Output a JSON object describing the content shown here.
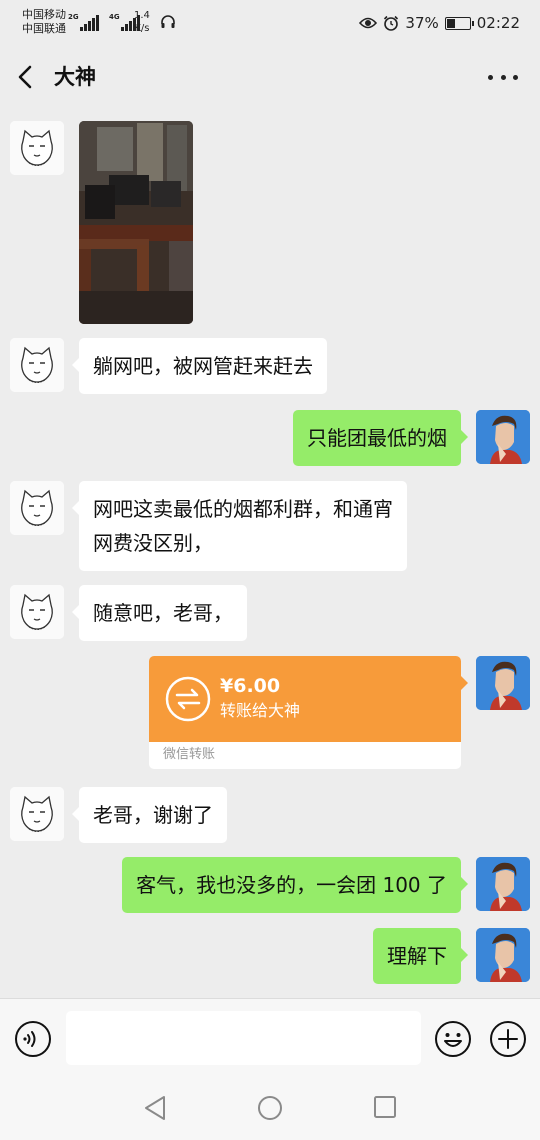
{
  "status_bar": {
    "carrier_1": "中国移动",
    "carrier_2": "中国联通",
    "net_1": "2G",
    "net_2": "4G",
    "speed_value": "1.4",
    "speed_unit": "K/s",
    "battery": "37%",
    "time": "02:22",
    "icons": [
      "signal-icon",
      "headset-icon",
      "eye-icon",
      "alarm-icon",
      "battery-icon"
    ]
  },
  "header": {
    "title": "大神",
    "back_icon": "chevron-left-icon",
    "more_icon": "more-icon"
  },
  "messages": [
    {
      "side": "left",
      "type": "image"
    },
    {
      "side": "left",
      "type": "text",
      "text": "躺网吧，被网管赶来赶去"
    },
    {
      "side": "right",
      "type": "text",
      "text": "只能团最低的烟"
    },
    {
      "side": "left",
      "type": "text",
      "lines": [
        "网吧这卖最低的烟都利群，和通宵",
        "网费没区别，"
      ]
    },
    {
      "side": "left",
      "type": "text",
      "text": "随意吧，老哥，"
    },
    {
      "side": "right",
      "type": "transfer",
      "amount": "¥6.00",
      "desc": "转账给大神",
      "footer": "微信转账"
    },
    {
      "side": "left",
      "type": "text",
      "text": "老哥，谢谢了"
    },
    {
      "side": "right",
      "type": "text",
      "text": "客气，我也没多的，一会团 100 了"
    },
    {
      "side": "right",
      "type": "text",
      "text": "理解下"
    }
  ],
  "input_bar": {
    "voice_icon": "voice-icon",
    "emoji_icon": "emoji-icon",
    "plus_icon": "plus-icon"
  },
  "colors": {
    "background": "#ededed",
    "bubble_self": "#95ec69",
    "bubble_other": "#ffffff",
    "transfer": "#f79b3a"
  }
}
